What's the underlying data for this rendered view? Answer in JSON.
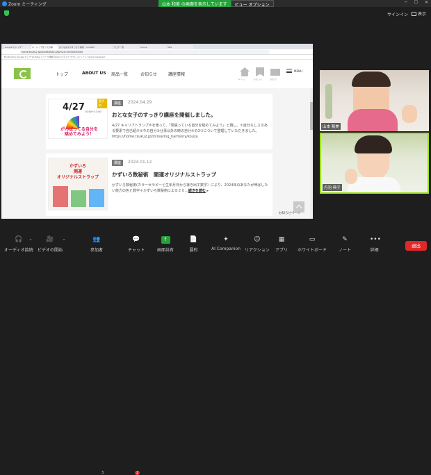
{
  "zoom": {
    "title": "Zoom ミーティング",
    "share_banner": "山本 和美 の画面を表示しています",
    "view_option": "ビュー オプション",
    "signin": "サインイン",
    "view": "表示"
  },
  "browser": {
    "tabs": [
      "Google カレンダー",
      "ホーム | 千葉 | 光の暮",
      "おとな女子のすっきり講座",
      "CodeMII",
      "ブログ一覧",
      "Canva",
      "SNS"
    ],
    "url": "home.tsuku2.jp/storeDetail.php?scd=0000000000",
    "bookmarks": "Bookmarks  Google マップ  YouTube  ニュース  翻訳  Gmail  ドライブ  スプレッドシート  Canva  Instagram"
  },
  "site": {
    "nav": [
      "トップ",
      "ABOUT US",
      "商品一覧",
      "お知らせ",
      "講座情報"
    ],
    "icons": [
      "マイページ",
      "お気に入り",
      "お問合せ"
    ],
    "menu": "MENU",
    "cards": [
      {
        "category": "講座",
        "date": "2024.04.29",
        "title": "おとな女子のすっきり講座を開催しました。",
        "body": "4/27 キャリアトランプ®を使って、「頑張っている自分を眺めてみよう」と題し、①自分らしさのある要素で自己紹介②今の自分③仕事以外の時の自分④の3つについて整理していただきました。https://home.tsuku2.jp/t/creating_harmony/kouza",
        "more": "",
        "thumb_date": "4/27",
        "thumb_time": "10:00〜11:00",
        "thumb_tag": "要予約",
        "thumb_caption": "がんばってる自分を\n眺めてみよう！"
      },
      {
        "category": "講座",
        "date": "2024.01.12",
        "title": "かずいろ数秘術　開運オリジナルストラップ",
        "body": "かずいろ数秘術(カラーセラピーと生年月日から導き出す数字）により、2024年のあなたが伸ばしたい能力の色と数字＋かずいろ数秘術によるＺ０…",
        "more": "続きを読む",
        "thumb_title": "かずいろ\n開運\nオリジナルストラップ"
      }
    ],
    "notice": "お知らせページ"
  },
  "participants": [
    {
      "name": "山本 和美"
    },
    {
      "name": "丹羽 典子"
    }
  ],
  "toolbar": {
    "audio": "オーディオ接続",
    "video": "ビデオの開始",
    "participants": "参加者",
    "participants_count": "3",
    "chat": "チャット",
    "chat_badge": "2",
    "share": "画面共有",
    "summary": "要約",
    "ai": "AI Companion",
    "reactions": "リアクション",
    "apps": "アプリ",
    "whiteboard": "ホワイトボード",
    "notes": "ノート",
    "more": "詳細",
    "end": "退出"
  },
  "colors": {
    "accent": "#25a33a",
    "site_green": "#8bc34a",
    "end": "#e02828",
    "active_speaker": "#9be11b"
  }
}
